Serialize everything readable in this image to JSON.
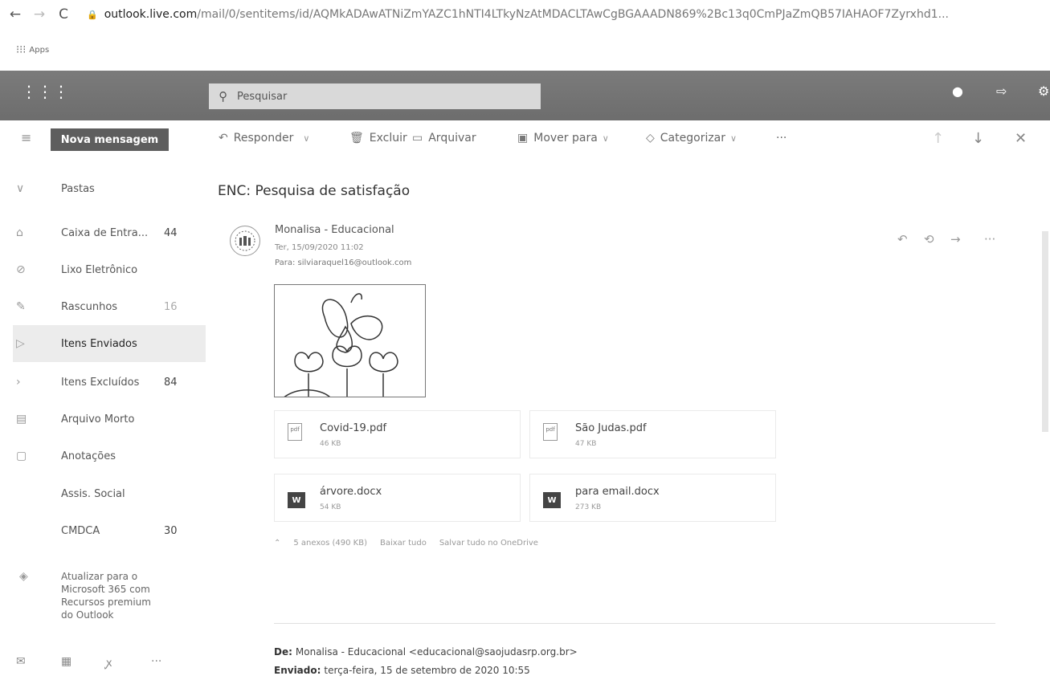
{
  "browser": {
    "url_host": "outlook.live.com",
    "url_path": "/mail/0/sentitems/id/AQMkADAwATNiZmYAZC1hNTI4LTkyNzAtMDACLTAwCgBGAAADN869%2Bc13q0CmPJaZmQB57IAHAOF7Zyrxhd1...",
    "bookmarks_label": "Apps"
  },
  "header": {
    "search_placeholder": "Pesquisar"
  },
  "toolbar": {
    "new_message": "Nova mensagem",
    "reply": "Responder",
    "delete": "Excluir",
    "archive": "Arquivar",
    "move": "Mover para",
    "categorize": "Categorizar",
    "more": "···"
  },
  "sidebar": {
    "folders_header": "Pastas",
    "items": [
      {
        "label": "Caixa de Entra...",
        "count": "44",
        "icon": "inbox-icon"
      },
      {
        "label": "Lixo Eletrônico",
        "count": "",
        "icon": "junk-icon"
      },
      {
        "label": "Rascunhos",
        "count": "16",
        "icon": "pencil-icon"
      },
      {
        "label": "Itens Enviados",
        "count": "",
        "icon": "send-icon"
      },
      {
        "label": "Itens Excluídos",
        "count": "84",
        "icon": "chevron-right-icon"
      },
      {
        "label": "Arquivo Morto",
        "count": "",
        "icon": "archive-icon"
      },
      {
        "label": "Anotações",
        "count": "",
        "icon": "note-icon"
      },
      {
        "label": "Assis. Social",
        "count": "",
        "icon": ""
      },
      {
        "label": "CMDCA",
        "count": "30",
        "icon": ""
      }
    ],
    "upgrade_text": "Atualizar para o Microsoft 365 com Recursos premium do Outlook"
  },
  "message": {
    "subject": "ENC: Pesquisa de satisfação",
    "sender": "Monalisa - Educacional",
    "date": "Ter, 15/09/2020 11:02",
    "to": "Para: silviaraquel16@outlook.com",
    "attachments": [
      {
        "name": "Covid-19.pdf",
        "size": "46 KB",
        "type": "pdf"
      },
      {
        "name": "São Judas.pdf",
        "size": "47 KB",
        "type": "pdf"
      },
      {
        "name": "árvore.docx",
        "size": "54 KB",
        "type": "word"
      },
      {
        "name": "para email.docx",
        "size": "273 KB",
        "type": "word"
      }
    ],
    "attachments_summary": "5 anexos (490 KB)",
    "download_all": "Baixar tudo",
    "save_onedrive": "Salvar tudo no OneDrive",
    "fwd_from_label": "De:",
    "fwd_from_value": "Monalisa - Educacional <educacional@saojudasrp.org.br>",
    "fwd_sent_label": "Enviado:",
    "fwd_sent_value": "terça-feira, 15 de setembro de 2020 10:55"
  }
}
